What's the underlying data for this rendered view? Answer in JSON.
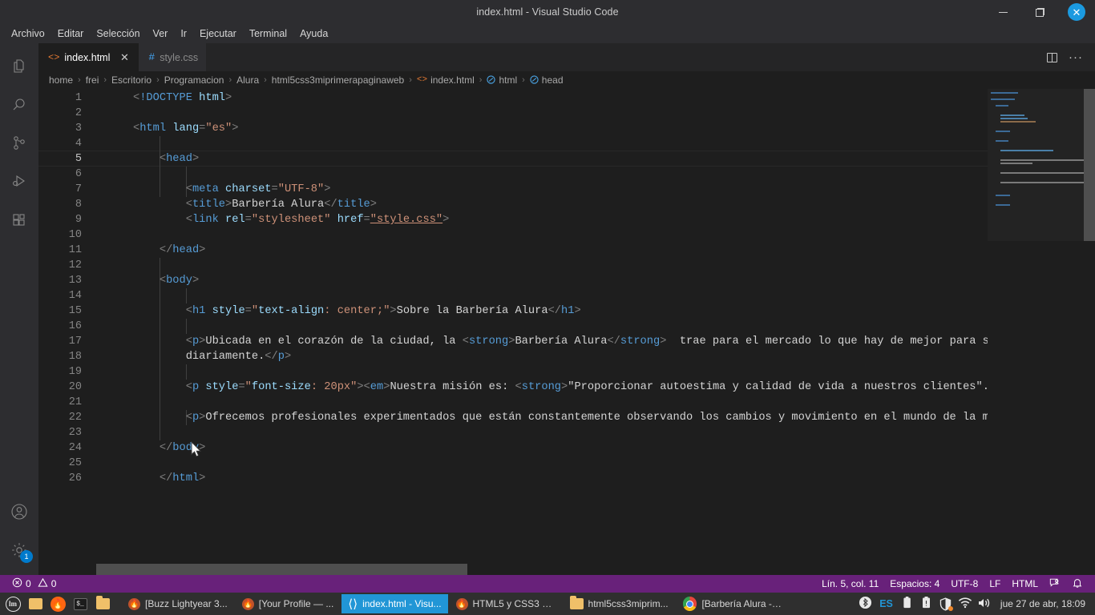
{
  "window": {
    "title": "index.html - Visual Studio Code",
    "minimize_label": "Minimizar",
    "maximize_label": "Restaurar",
    "close_label": "✕"
  },
  "menubar": {
    "items": [
      {
        "label": "Archivo"
      },
      {
        "label": "Editar"
      },
      {
        "label": "Selección"
      },
      {
        "label": "Ver"
      },
      {
        "label": "Ir"
      },
      {
        "label": "Ejecutar"
      },
      {
        "label": "Terminal"
      },
      {
        "label": "Ayuda"
      }
    ]
  },
  "activitybar": {
    "items": [
      {
        "name": "explorer-icon",
        "label": "Explorador"
      },
      {
        "name": "search-icon",
        "label": "Buscar"
      },
      {
        "name": "source-control-icon",
        "label": "Control de código fuente"
      },
      {
        "name": "run-debug-icon",
        "label": "Ejecutar y depurar"
      },
      {
        "name": "extensions-icon",
        "label": "Extensiones"
      }
    ],
    "bottom": [
      {
        "name": "account-icon",
        "label": "Cuentas"
      },
      {
        "name": "settings-gear-icon",
        "label": "Administrar",
        "badge": "1"
      }
    ]
  },
  "tabs": [
    {
      "label": "index.html",
      "icon": "<>",
      "active": true,
      "close": "✕"
    },
    {
      "label": "style.css",
      "icon": "#",
      "active": false
    }
  ],
  "tabbar_actions": [
    {
      "name": "split-editor-icon",
      "label": "Dividir editor"
    },
    {
      "name": "more-actions-icon",
      "label": "···"
    }
  ],
  "breadcrumb": {
    "segments": [
      {
        "label": "home",
        "icon": ""
      },
      {
        "label": "frei",
        "icon": ""
      },
      {
        "label": "Escritorio",
        "icon": ""
      },
      {
        "label": "Programacion",
        "icon": ""
      },
      {
        "label": "Alura",
        "icon": ""
      },
      {
        "label": "html5css3miprimerapaginaweb",
        "icon": ""
      },
      {
        "label": "index.html",
        "icon": "<>"
      },
      {
        "label": "html",
        "icon": "sym"
      },
      {
        "label": "head",
        "icon": "sym"
      }
    ],
    "separator": "›"
  },
  "editor": {
    "active_line": 5,
    "line_numbers": [
      1,
      2,
      3,
      4,
      5,
      6,
      7,
      8,
      9,
      10,
      11,
      12,
      13,
      14,
      15,
      16,
      17,
      18,
      19,
      20,
      21,
      22,
      23,
      24,
      25,
      26
    ],
    "lines": [
      {
        "n": 1,
        "text": "<!DOCTYPE html>"
      },
      {
        "n": 2,
        "text": ""
      },
      {
        "n": 3,
        "text": "<html lang=\"es\">"
      },
      {
        "n": 4,
        "text": ""
      },
      {
        "n": 5,
        "text": "    <head>"
      },
      {
        "n": 6,
        "text": ""
      },
      {
        "n": 7,
        "text": "        <meta charset=\"UTF-8\">"
      },
      {
        "n": 8,
        "text": "        <title>Barbería Alura</title>"
      },
      {
        "n": 9,
        "text": "        <link rel=\"stylesheet\" href=\"style.css\">"
      },
      {
        "n": 10,
        "text": ""
      },
      {
        "n": 11,
        "text": "    </head>"
      },
      {
        "n": 12,
        "text": ""
      },
      {
        "n": 13,
        "text": "    <body>"
      },
      {
        "n": 14,
        "text": ""
      },
      {
        "n": 15,
        "text": "        <h1 style=\"text-align: center;\">Sobre la Barbería Alura</h1>"
      },
      {
        "n": 16,
        "text": ""
      },
      {
        "n": 17,
        "text": "        <p>Ubicada en el corazón de la ciudad, la <strong>Barbería Alura</strong>  trae para el mercado lo que hay de mejor para su"
      },
      {
        "n": 18,
        "text": "        diariamente.</p>"
      },
      {
        "n": 19,
        "text": ""
      },
      {
        "n": 20,
        "text": "        <p style=\"font-size: 20px\"><em>Nuestra misión es: <strong>\"Proporcionar autoestima y calidad de vida a nuestros clientes\".</"
      },
      {
        "n": 21,
        "text": ""
      },
      {
        "n": 22,
        "text": "        <p>Ofrecemos profesionales experimentados que están constantemente observando los cambios y movimiento en el mundo de la mod"
      },
      {
        "n": 23,
        "text": ""
      },
      {
        "n": 24,
        "text": "    </body>"
      },
      {
        "n": 25,
        "text": ""
      },
      {
        "n": 26,
        "text": "    </html>"
      }
    ]
  },
  "statusbar": {
    "problems": {
      "errors": "0",
      "warnings": "0"
    },
    "cursor_position": "Lín. 5, col. 11",
    "indentation": "Espacios: 4",
    "encoding": "UTF-8",
    "eol": "LF",
    "language": "HTML",
    "feedback_label": "Tweet de opinión",
    "notifications_label": "Sin notificaciones",
    "background": "#68217a"
  },
  "taskbar": {
    "launchers": [
      {
        "name": "mint-menu-icon",
        "label": "Menú"
      },
      {
        "name": "show-desktop-icon",
        "label": "Mostrar escritorio"
      },
      {
        "name": "firefox-launcher-icon",
        "label": "Firefox"
      },
      {
        "name": "terminal-launcher-icon",
        "label": "Terminal"
      },
      {
        "name": "files-launcher-icon",
        "label": "Archivos"
      }
    ],
    "windows": [
      {
        "label": "[Buzz Lightyear 3...",
        "icon": "firefox",
        "active": false
      },
      {
        "label": "[Your Profile — ...",
        "icon": "firefox",
        "active": false
      },
      {
        "label": "index.html - Visu...",
        "icon": "vscode",
        "active": true
      },
      {
        "label": "HTML5 y CSS3 p...",
        "icon": "firefox",
        "active": false
      },
      {
        "label": "html5css3miprim...",
        "icon": "folder",
        "active": false
      },
      {
        "label": "[Barbería Alura - ...",
        "icon": "chrome",
        "active": false
      }
    ],
    "tray": [
      {
        "name": "bluetooth-icon",
        "label": "Bluetooth"
      },
      {
        "name": "keyboard-layout-indicator",
        "label": "ES"
      },
      {
        "name": "battery-icon",
        "label": "Batería"
      },
      {
        "name": "clipboard-icon",
        "label": "Portapapeles"
      },
      {
        "name": "update-shield-icon",
        "label": "Actualizaciones"
      },
      {
        "name": "wifi-icon",
        "label": "Red"
      },
      {
        "name": "volume-icon",
        "label": "Volumen"
      }
    ],
    "clock": "jue 27 de abr, 18:09"
  },
  "colors": {
    "accent": "#007acc",
    "statusbar": "#68217a",
    "tab_active_bg": "#1e1e1e",
    "editor_bg": "#1e1e1e",
    "taskbar_active": "#2196d6"
  }
}
